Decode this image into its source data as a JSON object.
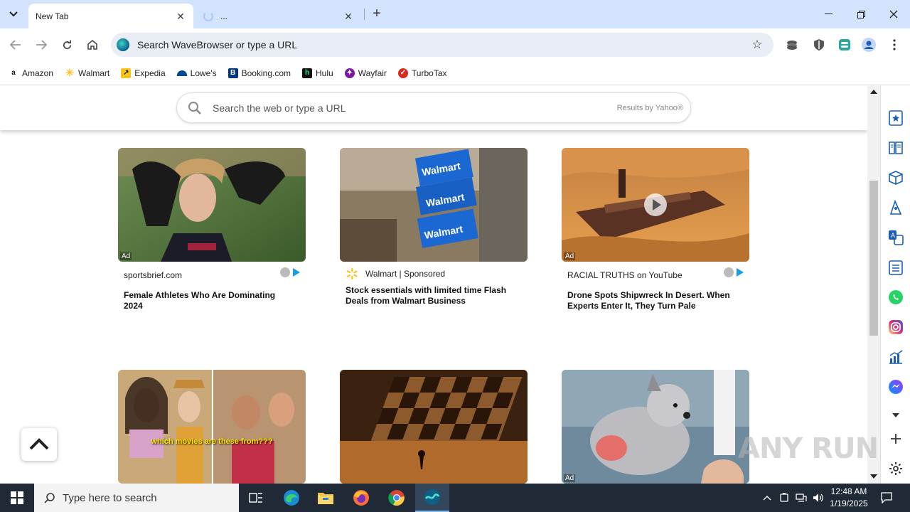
{
  "tabs": [
    {
      "title": "New Tab",
      "active": true
    },
    {
      "title": "...",
      "active": false
    }
  ],
  "omnibox": {
    "placeholder": "Search WaveBrowser or type a URL"
  },
  "bookmarks": [
    {
      "label": "Amazon",
      "icon": "amazon-icon",
      "color": "#111111"
    },
    {
      "label": "Walmart",
      "icon": "walmart-icon",
      "color": "#ffc220"
    },
    {
      "label": "Expedia",
      "icon": "expedia-icon",
      "color": "#f5c518"
    },
    {
      "label": "Lowe's",
      "icon": "lowes-icon",
      "color": "#004990"
    },
    {
      "label": "Booking.com",
      "icon": "booking-icon",
      "color": "#003580"
    },
    {
      "label": "Hulu",
      "icon": "hulu-icon",
      "color": "#111111"
    },
    {
      "label": "Wayfair",
      "icon": "wayfair-icon",
      "color": "#7b189f"
    },
    {
      "label": "TurboTax",
      "icon": "turbotax-icon",
      "color": "#d52b1e"
    }
  ],
  "page_search": {
    "placeholder": "Search the web or type a URL",
    "results_by": "Results by Yahoo®"
  },
  "cards": [
    {
      "source": "sportsbrief.com",
      "title": "Female Athletes Who Are Dominating 2024",
      "ad": "Ad"
    },
    {
      "source": "Walmart | Sponsored",
      "title": "Stock essentials with limited time Flash Deals from Walmart Business",
      "ad": ""
    },
    {
      "source": "RACIAL TRUTHS on YouTube",
      "title": "Drone Spots Shipwreck In Desert. When Experts Enter It, They Turn Pale",
      "ad": "Ad"
    },
    {
      "caption": "which movies are these from???"
    },
    {},
    {
      "ad": "Ad"
    }
  ],
  "taskbar": {
    "search_placeholder": "Type here to search",
    "time": "12:48 AM",
    "date": "1/19/2025"
  },
  "watermark": "ANY RUN",
  "colors": {
    "accent": "#d3e3fd",
    "taskbar": "#1f2a36"
  }
}
